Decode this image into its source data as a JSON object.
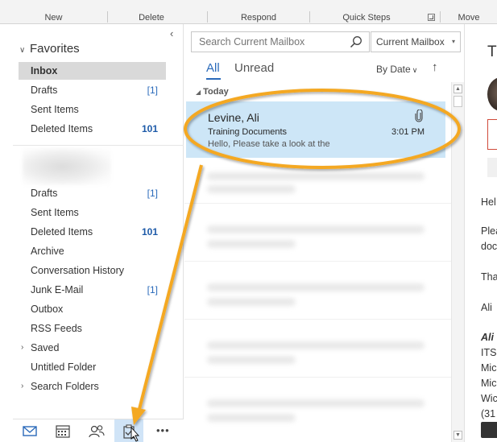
{
  "ribbon": {
    "groups": [
      "New",
      "Delete",
      "Respond",
      "Quick Steps",
      "Move"
    ]
  },
  "folder_pane": {
    "favorites_label": "Favorites",
    "favorites": [
      {
        "label": "Inbox",
        "count": ""
      },
      {
        "label": "Drafts",
        "count": "[1]"
      },
      {
        "label": "Sent Items",
        "count": ""
      },
      {
        "label": "Deleted Items",
        "count": "101"
      }
    ],
    "folders": [
      {
        "label": "Drafts",
        "count": "[1]"
      },
      {
        "label": "Sent Items",
        "count": ""
      },
      {
        "label": "Deleted Items",
        "count": "101"
      },
      {
        "label": "Archive",
        "count": ""
      },
      {
        "label": "Conversation History",
        "count": ""
      },
      {
        "label": "Junk E-Mail",
        "count": "[1]"
      },
      {
        "label": "Outbox",
        "count": ""
      },
      {
        "label": "RSS Feeds",
        "count": ""
      },
      {
        "label": "Saved",
        "count": ""
      },
      {
        "label": "Untitled Folder",
        "count": ""
      },
      {
        "label": "Search Folders",
        "count": ""
      }
    ]
  },
  "nav": {
    "items": [
      "mail-icon",
      "calendar-icon",
      "people-icon",
      "tasks-icon",
      "more-icon"
    ],
    "more_label": "•••"
  },
  "list": {
    "search_placeholder": "Search Current Mailbox",
    "scope": "Current Mailbox",
    "tab_all": "All",
    "tab_unread": "Unread",
    "sort_label": "By Date",
    "sort_direction": "↑",
    "group_today": "Today",
    "message": {
      "sender": "Levine, Ali",
      "subject": "Training Documents",
      "preview": "Hello,  Please take a look at the",
      "time": "3:01 PM"
    }
  },
  "reading": {
    "title": "Tr",
    "lines": [
      "Hel",
      "Plea",
      "doc",
      "Tha",
      "Ali",
      "Ali",
      "ITS",
      "Mic",
      "Mic",
      "Wic",
      "(31"
    ]
  },
  "colors": {
    "accent": "#2a6aba",
    "highlight": "#f4a820",
    "selection": "#cde6f7"
  }
}
